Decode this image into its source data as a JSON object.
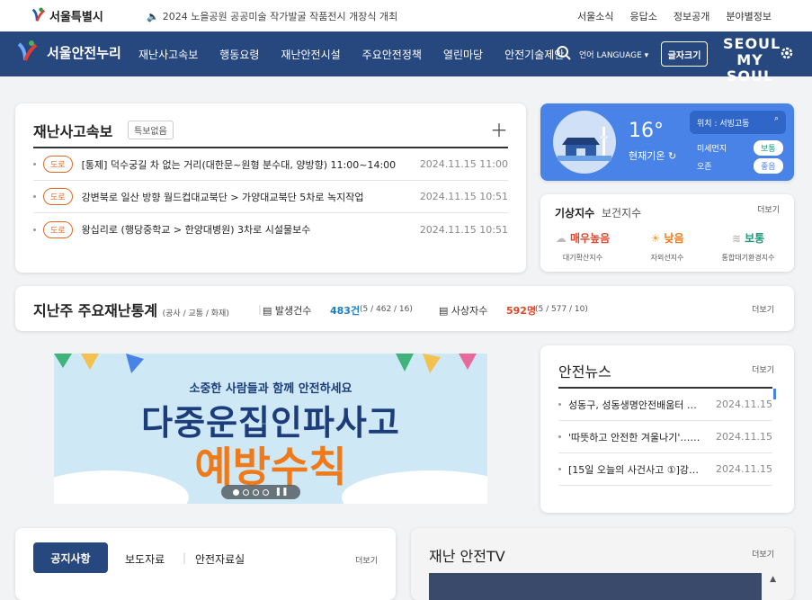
{
  "top": {
    "logo": "서울특별시",
    "notice": "2024 노을공원 공공미술 작가발굴 작품전시 개장식 개최",
    "links": [
      "서울소식",
      "응답소",
      "정보공개",
      "분야별정보"
    ]
  },
  "nav": {
    "brand": "서울안전누리",
    "menu": [
      "재난사고속보",
      "행동요령",
      "재난안전시설",
      "주요안전정책",
      "열린마당",
      "안전기술제안"
    ],
    "lang_prefix": "언어",
    "lang": "LANGUAGE",
    "font_button": "글자크기",
    "slogan_top": "SEOUL",
    "slogan_bottom": "MY SOUL"
  },
  "disaster": {
    "title": "재난사고속보",
    "badge": "특보없음",
    "items": [
      {
        "tag": "도로",
        "text": "[통제] 덕수궁길 차 없는 거리(대한문~원형 분수대, 양방향) 11:00~14:00",
        "date": "2024.11.15 11:00"
      },
      {
        "tag": "도로",
        "text": "강변북로 일산 방향 월드컵대교북단 > 가양대교북단 5차로 녹지작업",
        "date": "2024.11.15 10:51"
      },
      {
        "tag": "도로",
        "text": "왕십리로 (행당중학교 > 한양대병원) 3차로 시설물보수",
        "date": "2024.11.15 10:51"
      }
    ]
  },
  "weather": {
    "temp": "16°",
    "sub": "현재기온",
    "location": "위치 : 서빙고동",
    "dust_label": "미세먼지",
    "dust_value": "보통",
    "ozone_label": "오존",
    "ozone_value": "좋음"
  },
  "index": {
    "title": "기상지수",
    "title2": "보건지수",
    "more": "더보기",
    "items": [
      {
        "value": "매우높음",
        "label": "대기확산지수",
        "color": "#e0452a"
      },
      {
        "value": "낮음",
        "label": "자외선지수",
        "color": "#f07a1a"
      },
      {
        "value": "보통",
        "label": "통합대기환경지수",
        "color": "#1a9a7a"
      }
    ]
  },
  "stats": {
    "title": "지난주 주요재난통계",
    "sub": "(공사 / 교통 / 화재)",
    "occ_label": "발생건수",
    "occ_value": "483건",
    "occ_detail": "(5 / 462 / 16)",
    "cas_label": "사상자수",
    "cas_value": "592명",
    "cas_detail": "(5 / 577 / 10)",
    "more": "더보기"
  },
  "banner": {
    "line1": "소중한 사람들과 함께 안전하세요",
    "line2": "다중운집인파사고",
    "line3": "예방수칙"
  },
  "news": {
    "title": "안전뉴스",
    "more": "더보기",
    "items": [
      {
        "text": "성동구, 성동생명안전배움터 …",
        "date": "2024.11.15"
      },
      {
        "text": "'따뜻하고 안전한 겨울나기'……",
        "date": "2024.11.15"
      },
      {
        "text": "[15일 오늘의 사건사고 ①]강…",
        "date": "2024.11.15"
      }
    ]
  },
  "notices": {
    "tabs": [
      "공지사항",
      "보도자료",
      "안전자료실"
    ],
    "more": "더보기"
  },
  "tv": {
    "title": "재난 안전TV",
    "more": "더보기"
  }
}
